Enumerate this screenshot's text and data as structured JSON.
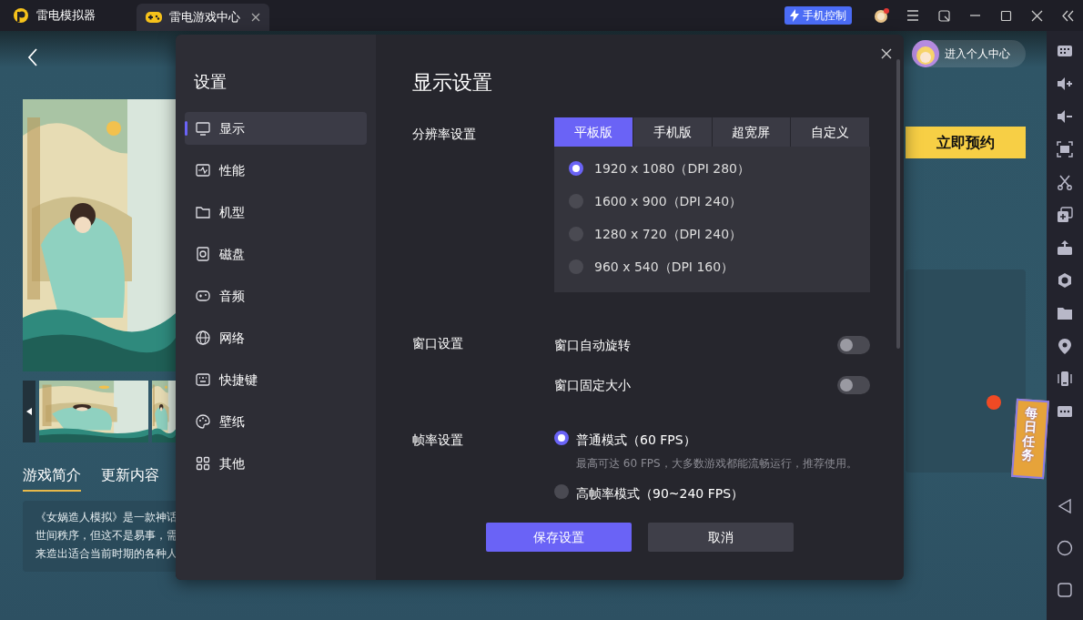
{
  "titlebar": {
    "app_name": "雷电模拟器",
    "tabs": [
      {
        "label": "雷电游戏中心",
        "selected": true
      }
    ],
    "phone_control": "手机控制"
  },
  "page": {
    "description_tabs": [
      {
        "label": "游戏简介",
        "selected": true
      },
      {
        "label": "更新内容",
        "selected": false
      }
    ],
    "description_lines": [
      "《女娲造人模拟》是一款神话",
      "世间秩序，但这不是易事，需",
      "来造出适合当前时期的各种人"
    ],
    "profile_link": "进入个人中心",
    "reserve_button": "立即预约",
    "daily_task_badge": "每日任务"
  },
  "settings": {
    "title": "设置",
    "nav": [
      {
        "label": "显示",
        "selected": true
      },
      {
        "label": "性能",
        "selected": false
      },
      {
        "label": "机型",
        "selected": false
      },
      {
        "label": "磁盘",
        "selected": false
      },
      {
        "label": "音频",
        "selected": false
      },
      {
        "label": "网络",
        "selected": false
      },
      {
        "label": "快捷键",
        "selected": false
      },
      {
        "label": "壁纸",
        "selected": false
      },
      {
        "label": "其他",
        "selected": false
      }
    ],
    "heading": "显示设置",
    "resolution": {
      "label": "分辨率设置",
      "tabs": [
        {
          "label": "平板版",
          "selected": true
        },
        {
          "label": "手机版",
          "selected": false
        },
        {
          "label": "超宽屏",
          "selected": false
        },
        {
          "label": "自定义",
          "selected": false
        }
      ],
      "options": [
        {
          "label": "1920 x 1080（DPI 280）",
          "selected": true
        },
        {
          "label": "1600 x 900（DPI 240）",
          "selected": false
        },
        {
          "label": "1280 x 720（DPI 240）",
          "selected": false
        },
        {
          "label": "960 x 540（DPI 160）",
          "selected": false
        }
      ]
    },
    "window": {
      "label": "窗口设置",
      "toggles": [
        {
          "label": "窗口自动旋转",
          "on": false
        },
        {
          "label": "窗口固定大小",
          "on": false
        }
      ]
    },
    "framerate": {
      "label": "帧率设置",
      "options": [
        {
          "label": "普通模式（60 FPS）",
          "hint": "最高可达 60 FPS，大多数游戏都能流畅运行，推荐使用。",
          "selected": true
        },
        {
          "label": "高帧率模式（90~240 FPS）",
          "selected": false
        }
      ]
    },
    "buttons": [
      {
        "label": "保存设置",
        "kind": "primary"
      },
      {
        "label": "取消",
        "kind": "secondary"
      }
    ]
  }
}
